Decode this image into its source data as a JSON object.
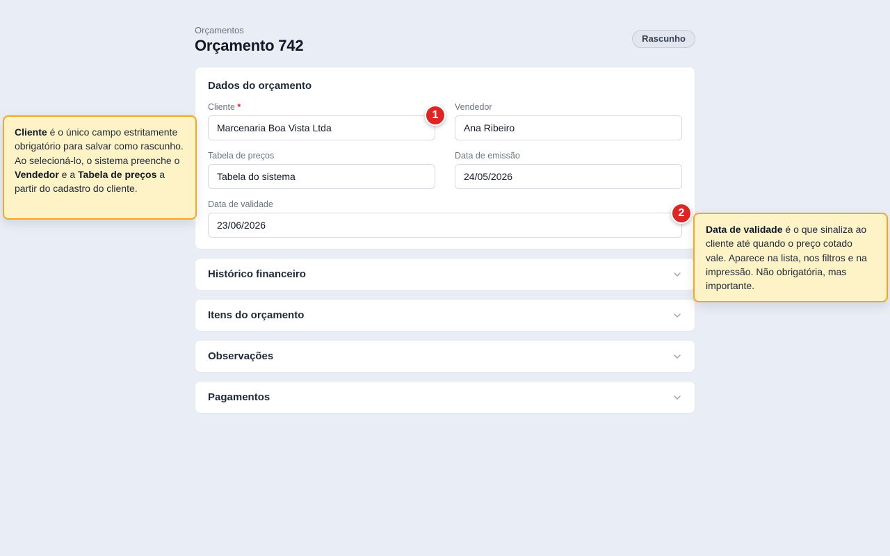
{
  "header": {
    "breadcrumb": "Orçamentos",
    "title": "Orçamento 742",
    "status": "Rascunho"
  },
  "form": {
    "section_title": "Dados do orçamento",
    "cliente": {
      "label": "Cliente",
      "required_mark": "*",
      "value": "Marcenaria Boa Vista Ltda"
    },
    "vendedor": {
      "label": "Vendedor",
      "value": "Ana Ribeiro"
    },
    "tabela_precos": {
      "label": "Tabela de preços",
      "value": "Tabela do sistema"
    },
    "data_emissao": {
      "label": "Data de emissão",
      "value": "24/05/2026"
    },
    "data_validade": {
      "label": "Data de validade",
      "value": "23/06/2026"
    }
  },
  "sections": [
    {
      "label": "Histórico financeiro"
    },
    {
      "label": "Itens do orçamento"
    },
    {
      "label": "Observações"
    },
    {
      "label": "Pagamentos"
    }
  ],
  "markers": [
    "1",
    "2"
  ],
  "callouts": {
    "one": {
      "bold_1": "Cliente",
      "text_1": " é o único campo estritamente obrigatório para salvar como rascunho. Ao selecioná-lo, o sistema preenche o ",
      "bold_2": "Vendedor",
      "text_2": " e a ",
      "bold_3": "Tabela de preços",
      "text_3": " a partir do cadastro do cliente."
    },
    "two": {
      "bold_1": "Data de validade",
      "text_1": " é o que sinaliza ao cliente até quando o preço cotado vale. Aparece na lista, nos filtros e na impressão. Não obrigatória, mas importante."
    }
  },
  "icons": {
    "section_toggle": "chevron-down-icon"
  },
  "colors": {
    "background": "#e9edf5",
    "marker": "#dc2626",
    "callout_bg": "#fef3c7",
    "callout_border": "#f5a623"
  }
}
